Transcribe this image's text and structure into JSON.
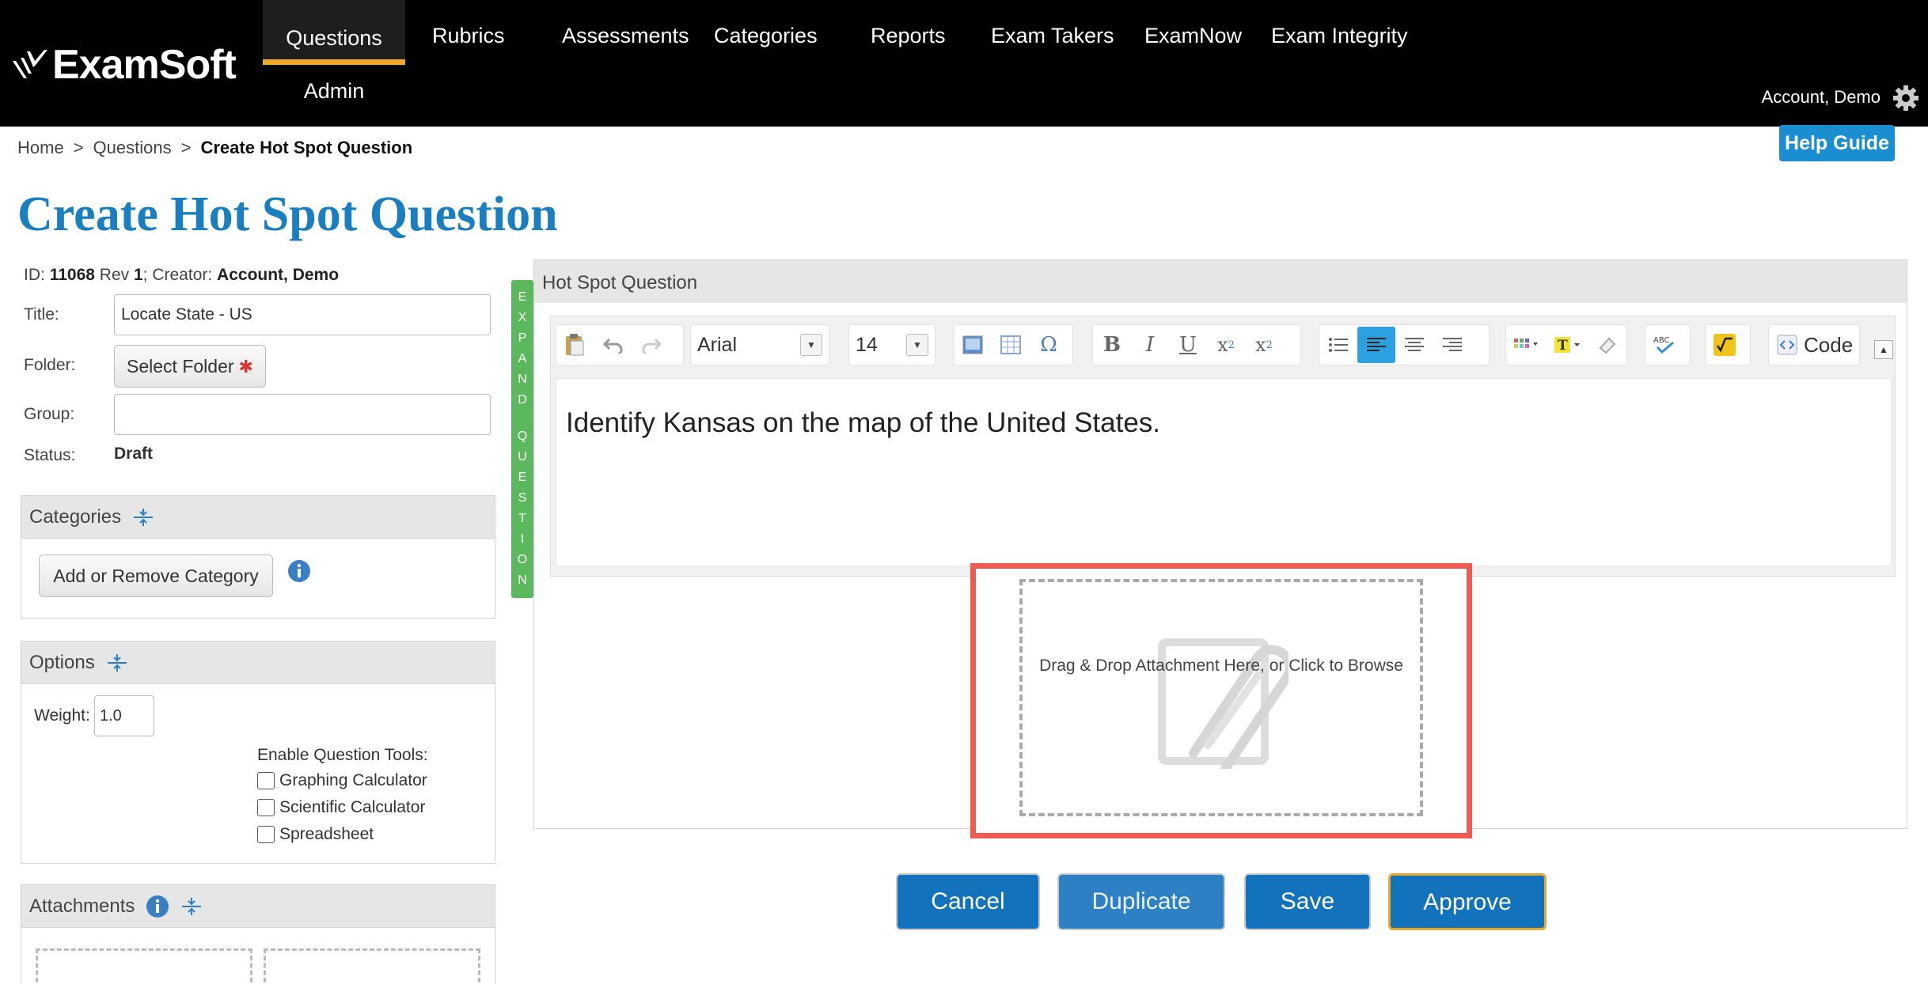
{
  "header": {
    "logo_text": "ExamSoft",
    "nav": [
      {
        "label": "Questions"
      },
      {
        "label": "Rubrics"
      },
      {
        "label": "Assessments"
      },
      {
        "label": "Categories"
      },
      {
        "label": "Reports"
      },
      {
        "label": "Exam Takers"
      },
      {
        "label": "ExamNow"
      },
      {
        "label": "Exam Integrity"
      }
    ],
    "admin_label": "Admin",
    "account_label": "Account, Demo"
  },
  "breadcrumb": {
    "home": "Home",
    "sep": ">",
    "questions": "Questions",
    "current": "Create Hot Spot Question"
  },
  "help_label": "Help Guide",
  "page_title": "Create Hot Spot Question",
  "meta": {
    "id_label": "ID:",
    "id": "11068",
    "rev_label": "Rev",
    "rev": "1",
    "creator_label": "; Creator:",
    "creator": "Account, Demo"
  },
  "form": {
    "title_label": "Title:",
    "title_value": "Locate State - US",
    "folder_label": "Folder:",
    "folder_button": "Select Folder",
    "required_mark": "✱",
    "group_label": "Group:",
    "group_value": "",
    "status_label": "Status:",
    "status_value": "Draft"
  },
  "categories": {
    "heading": "Categories",
    "button": "Add or Remove Category"
  },
  "options": {
    "heading": "Options",
    "weight_label": "Weight:",
    "weight_value": "1.0",
    "tools_label": "Enable Question Tools:",
    "tools": [
      {
        "label": "Graphing Calculator",
        "checked": false
      },
      {
        "label": "Scientific Calculator",
        "checked": false
      },
      {
        "label": "Spreadsheet",
        "checked": false
      }
    ]
  },
  "attachments": {
    "heading": "Attachments"
  },
  "expand_letters": [
    "E",
    "X",
    "P",
    "A",
    "N",
    "D",
    " ",
    "Q",
    "U",
    "E",
    "S",
    "T",
    "I",
    "O",
    "N"
  ],
  "editor": {
    "panel_title": "Hot Spot Question",
    "font": "Arial",
    "size": "14",
    "code_label": "Code",
    "content": "Identify Kansas on the map of the United States."
  },
  "dropzone": {
    "text": "Drag & Drop Attachment Here, or Click to Browse"
  },
  "actions": {
    "cancel": "Cancel",
    "duplicate": "Duplicate",
    "save": "Save",
    "approve": "Approve"
  },
  "colors": {
    "brand_blue": "#1a7fc1",
    "button_blue": "#1272bb",
    "active_tab": "#f0a92a",
    "expand_green": "#5cb85c",
    "highlight_red": "#ef5b50"
  }
}
